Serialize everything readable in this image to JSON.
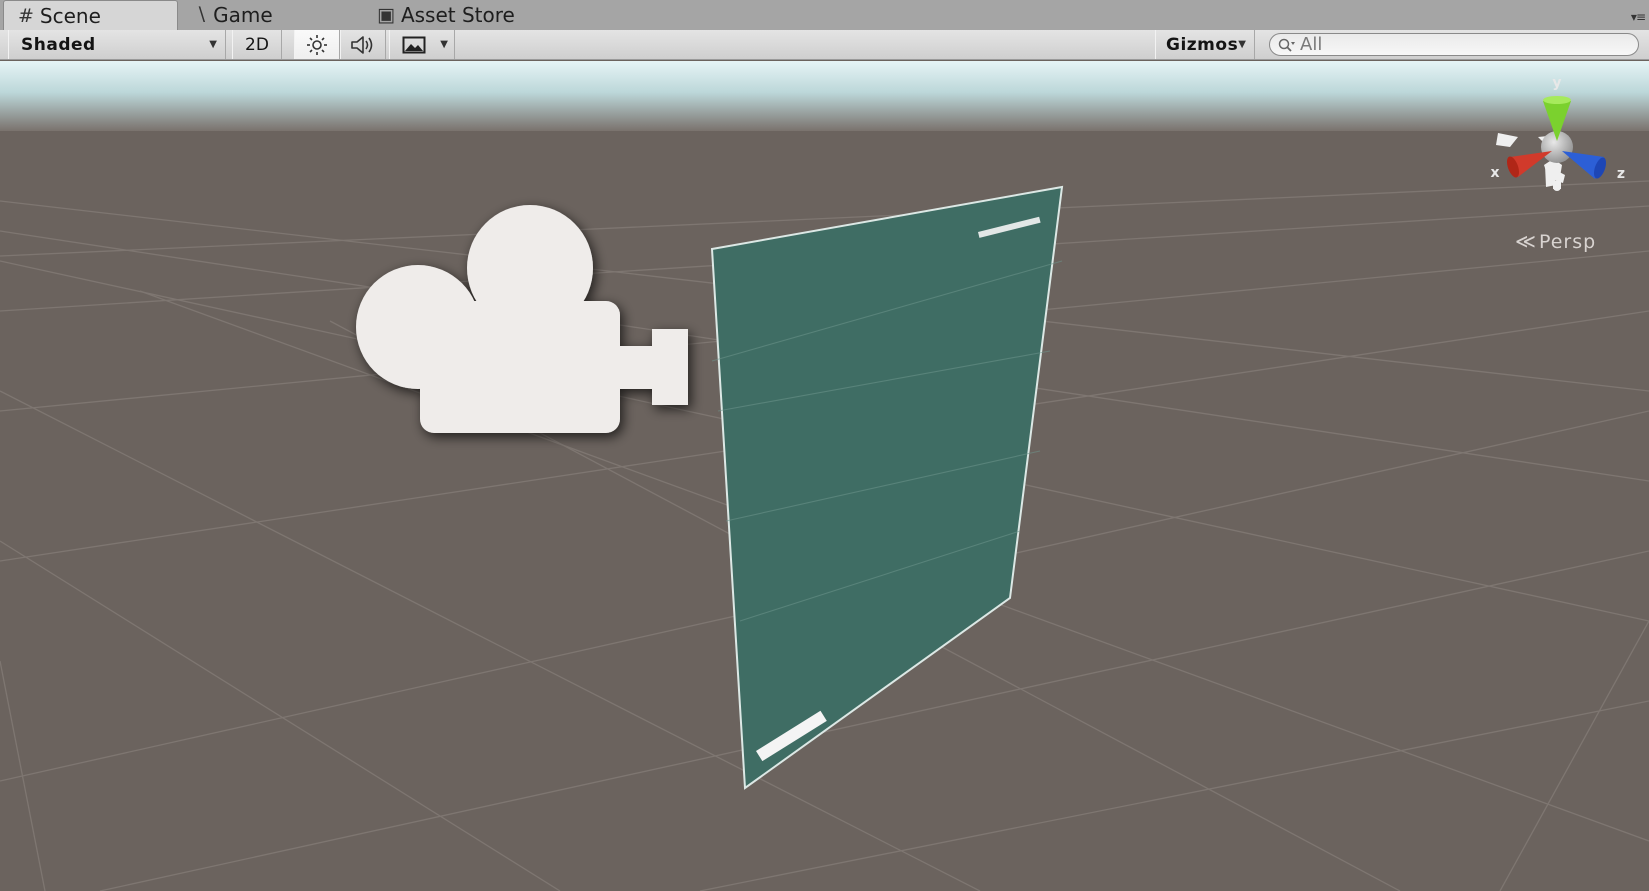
{
  "tabs": [
    {
      "label": "Scene",
      "icon": "scene-grid-icon",
      "active": true
    },
    {
      "label": "Game",
      "icon": "game-controller-icon",
      "active": false
    },
    {
      "label": "Asset Store",
      "icon": "asset-store-bag-icon",
      "active": false
    }
  ],
  "toolbar": {
    "shading_mode": "Shaded",
    "toggle_2d": "2D",
    "lighting_icon": "sun-icon",
    "audio_icon": "speaker-icon",
    "effects_icon": "image-icon",
    "gizmos_label": "Gizmos",
    "search_placeholder": "All"
  },
  "scene": {
    "projection_label": "Persp",
    "gizmo_axes": {
      "x": "x",
      "y": "y",
      "z": "z"
    },
    "colors": {
      "sky": "#c6e4e7",
      "ground": "#6b635e",
      "plane": "#3e6f66",
      "axis_x": "#d13a2b",
      "axis_y": "#7bd12e",
      "axis_z": "#2c5fd6"
    }
  }
}
